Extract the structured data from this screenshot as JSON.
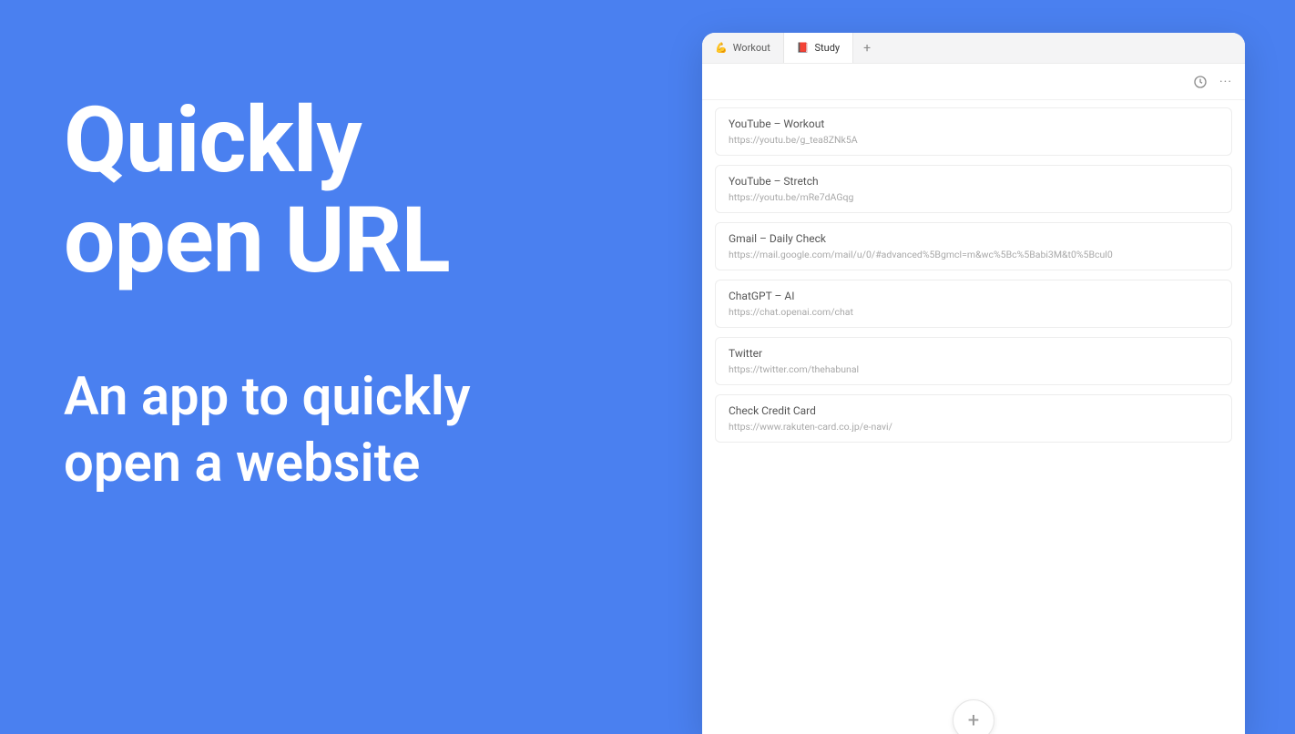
{
  "hero": {
    "headline_line1": "Quickly",
    "headline_line2": "open URL",
    "subline_line1": "An app to quickly",
    "subline_line2": "open a website"
  },
  "tabs": [
    {
      "icon": "💪",
      "label": "Workout"
    },
    {
      "icon": "📕",
      "label": "Study"
    }
  ],
  "toolbar": {
    "more_glyph": "···"
  },
  "items": [
    {
      "title": "YouTube – Workout",
      "url": "https://youtu.be/g_tea8ZNk5A"
    },
    {
      "title": "YouTube – Stretch",
      "url": "https://youtu.be/mRe7dAGqg"
    },
    {
      "title": "Gmail – Daily Check",
      "url": "https://mail.google.com/mail/u/0/#advanced%5Bgmcl=m&wc%5Bc%5Babi3M&t0%5Bcul0"
    },
    {
      "title": "ChatGPT – AI",
      "url": "https://chat.openai.com/chat"
    },
    {
      "title": "Twitter",
      "url": "https://twitter.com/thehabunal"
    },
    {
      "title": "Check Credit Card",
      "url": "https://www.rakuten-card.co.jp/e-navi/"
    }
  ],
  "fab_glyph": "+",
  "add_tab_glyph": "+"
}
